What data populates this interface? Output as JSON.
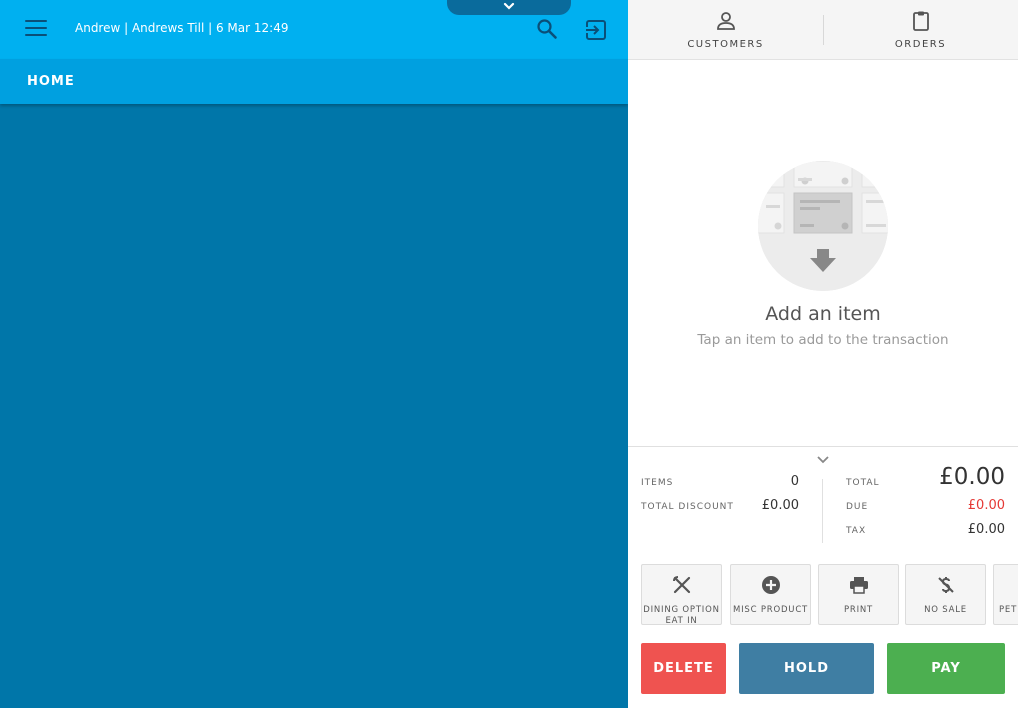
{
  "header": {
    "session": "Andrew | Andrews Till | 6 Mar 12:49",
    "section": "HOME"
  },
  "right_header": {
    "customers_label": "CUSTOMERS",
    "orders_label": "ORDERS"
  },
  "empty_state": {
    "title": "Add an item",
    "subtitle": "Tap an item to add to the transaction"
  },
  "summary": {
    "items_label": "ITEMS",
    "items_value": "0",
    "discount_label": "TOTAL DISCOUNT",
    "discount_value": "£0.00",
    "total_label": "TOTAL",
    "total_value": "£0.00",
    "due_label": "DUE",
    "due_value": "£0.00",
    "tax_label": "TAX",
    "tax_value": "£0.00"
  },
  "actions": {
    "dining_line1": "DINING OPTION",
    "dining_line2": "EAT IN",
    "misc": "MISC PRODUCT",
    "print": "PRINT",
    "nosale": "NO SALE",
    "partial": "PET"
  },
  "buttons": {
    "delete": "DELETE",
    "hold": "HOLD",
    "pay": "PAY"
  },
  "colors": {
    "topbar": "#00b0f0",
    "homebar": "#00a0e0",
    "main_bg": "#0076a9",
    "delete": "#ef5350",
    "hold": "#3f7ea3",
    "pay": "#4caf50",
    "due_red": "#e53935"
  }
}
